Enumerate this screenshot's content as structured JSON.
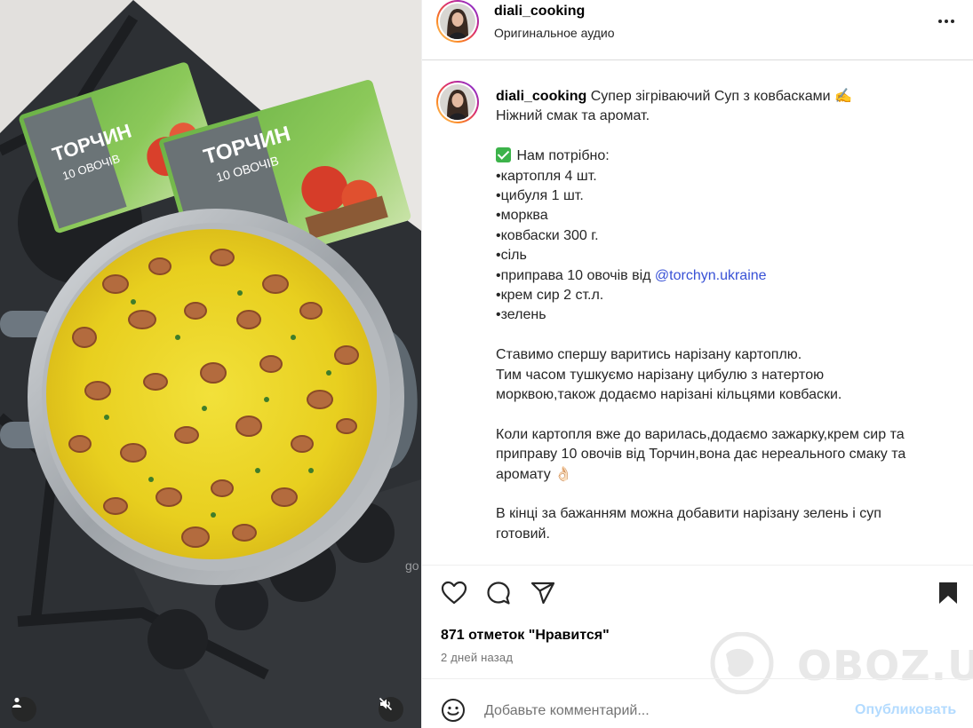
{
  "colors": {
    "accent_link": "#3851d6",
    "publish_disabled": "#b3dbff",
    "ring_gradient": [
      "#feda75",
      "#fa7e1e",
      "#d62976",
      "#962fbf",
      "#4f5bd5"
    ]
  },
  "header": {
    "username": "diali_cooking",
    "audio": "Оригинальное аудио",
    "more_icon": "more-horizontal-icon"
  },
  "media": {
    "package_brand": "ТОРЧИН",
    "package_subtitle": "10 ОВОЧІВ",
    "stove_brand": "go",
    "user_tag_icon": "person-icon",
    "mute_icon": "speaker-muted-icon"
  },
  "caption": {
    "username": "diali_cooking",
    "title": " Супер зігріваючий Суп з ковбасками",
    "title_emoji": "✍️",
    "line2": "Ніжний смак та аромат.",
    "needed_label": " Нам потрібно:",
    "ingredients": [
      "•картопля 4 шт.",
      "•цибуля 1 шт.",
      "•морква",
      "•ковбаски 300 г.",
      "•сіль",
      "•приправа 10 овочів від ",
      "•крем сир 2 ст.л.",
      "•зелень"
    ],
    "mention": "@torchyn.ukraine",
    "step1": [
      "Ставимо спершу варитись нарізану картоплю.",
      "Тим часом тушкуємо нарізану цибулю з натертою",
      "морквою,також додаємо нарізані кільцями ковбаски."
    ],
    "step2": [
      "Коли картопля вже до варилась,додаємо зажарку,крем сир та",
      "приправу 10 овочів від Торчин,вона дає нереального смаку та",
      "аромату"
    ],
    "step2_emoji": "👌🏻",
    "step3": [
      "В кінці за бажанням можна добавити нарізану зелень і суп",
      "готовий."
    ]
  },
  "actions": {
    "like_icon": "heart-icon",
    "comment_icon": "comment-icon",
    "share_icon": "paper-plane-icon",
    "save_icon": "bookmark-icon"
  },
  "likes_text": "871 отметок \"Нравится\"",
  "time_ago": "2 дней назад",
  "comment_box": {
    "emoji_icon": "smiley-icon",
    "placeholder": "Добавьте комментарий...",
    "publish_label": "Опубликовать"
  },
  "watermark": {
    "text": "OBOZ.UA"
  }
}
